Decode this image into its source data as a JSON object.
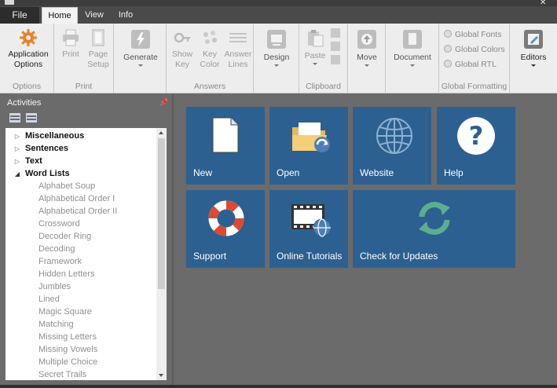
{
  "menu": {
    "file": "File",
    "tabs": [
      "Home",
      "View",
      "Info"
    ]
  },
  "ribbon": {
    "options": {
      "button": [
        "Application",
        "Options"
      ],
      "label": "Options"
    },
    "print": {
      "print": "Print",
      "page_setup": [
        "Page",
        "Setup"
      ],
      "label": "Print"
    },
    "generate": {
      "button": "Generate"
    },
    "answers": {
      "show_key": [
        "Show",
        "Key"
      ],
      "key_color": [
        "Key",
        "Color"
      ],
      "answer_lines": [
        "Answer",
        "Lines"
      ],
      "label": "Answers"
    },
    "design": {
      "button": "Design"
    },
    "clipboard": {
      "paste": "Paste",
      "label": "Clipboard"
    },
    "move": {
      "button": "Move"
    },
    "document": {
      "button": "Document"
    },
    "global_formatting": {
      "fonts": "Global Fonts",
      "colors": "Global Colors",
      "rtl": "Global RTL",
      "label": "Global Formatting"
    },
    "editors": {
      "button": "Editors"
    }
  },
  "pane": {
    "title": "Activities",
    "categories": [
      "Miscellaneous",
      "Sentences",
      "Text",
      "Word Lists"
    ],
    "word_lists": [
      "Alphabet Soup",
      "Alphabetical Order I",
      "Alphabetical Order II",
      "Crossword",
      "Decoder Ring",
      "Decoding",
      "Framework",
      "Hidden Letters",
      "Jumbles",
      "Lined",
      "Magic Square",
      "Matching",
      "Missing Letters",
      "Missing Vowels",
      "Multiple Choice",
      "Secret Trails"
    ]
  },
  "tiles": {
    "new": "New",
    "open": "Open",
    "website": "Website",
    "help": "Help",
    "support": "Support",
    "tutorials": "Online Tutorials",
    "updates": "Check for Updates"
  },
  "colors": {
    "tile": "#2c6091",
    "workspace": "#6b6b6b",
    "ribbon": "#ededed"
  }
}
